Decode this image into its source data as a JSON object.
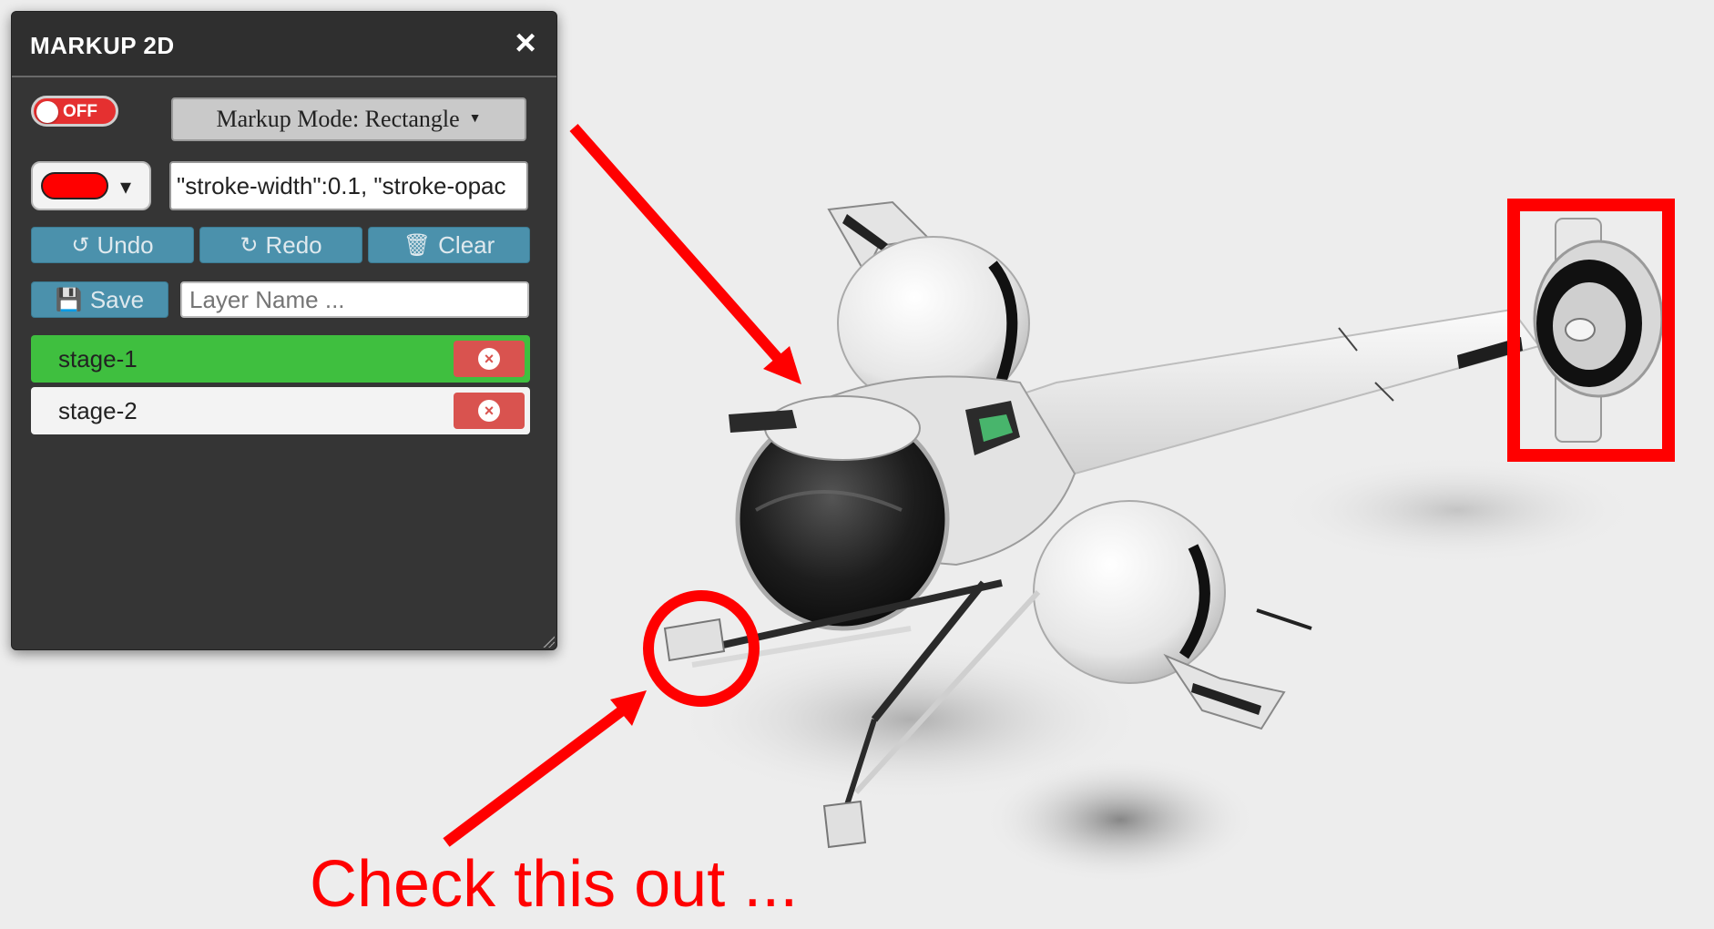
{
  "panel": {
    "title": "MARKUP 2D",
    "close_icon": "close-icon",
    "toggle_label": "OFF",
    "mode_label": "Markup Mode: Rectangle",
    "stroke_color": "#ff0000",
    "style_value": "\"stroke-width\":0.1, \"stroke-opac",
    "buttons": {
      "undo": "Undo",
      "redo": "Redo",
      "clear": "Clear",
      "save": "Save"
    },
    "layer_name_placeholder": "Layer Name ...",
    "layers": [
      {
        "name": "stage-1",
        "active": true
      },
      {
        "name": "stage-2",
        "active": false
      }
    ]
  },
  "colors": {
    "panel_bg": "#353535",
    "button_blue": "#4b91ac",
    "toggle_off": "#e53030",
    "active_layer": "#3fbf3f",
    "delete_red": "#d9534f",
    "markup_red": "#ff0000"
  },
  "annotation_text": "Check this out ..."
}
